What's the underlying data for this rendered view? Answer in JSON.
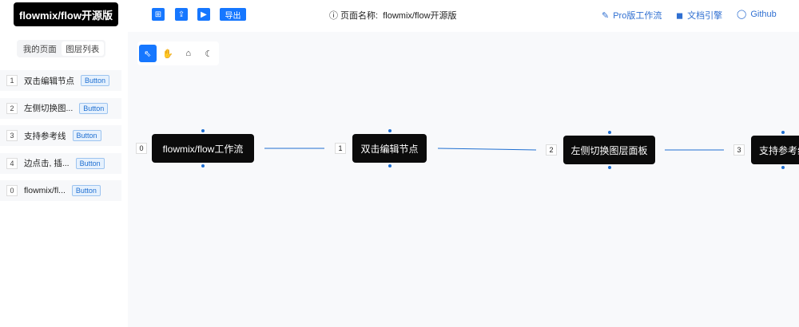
{
  "header": {
    "logo": "flowmix/flow开源版",
    "toolbar": [
      "⊞",
      "⇪",
      "▶"
    ],
    "export_label": "导出",
    "page_name_label": "ⓘ 页面名称:",
    "page_name": "flowmix/flow开源版",
    "links": [
      {
        "icon": "✎",
        "label": "Pro版工作流"
      },
      {
        "icon": "◼",
        "label": "文档引擎"
      },
      {
        "icon": "◯",
        "label": "Github"
      }
    ]
  },
  "sidebar": {
    "tabs": [
      "我的页面",
      "图层列表"
    ],
    "layers": [
      {
        "num": "1",
        "label": "双击编辑节点",
        "button": "Button"
      },
      {
        "num": "2",
        "label": "左侧切换图...",
        "button": "Button"
      },
      {
        "num": "3",
        "label": "支持参考线",
        "button": "Button"
      },
      {
        "num": "4",
        "label": "边点击, 插...",
        "button": "Button"
      },
      {
        "num": "0",
        "label": "flowmix/fl...",
        "button": "Button"
      }
    ]
  },
  "canvas": {
    "tools": [
      "⇖",
      "✋",
      "⌂",
      "☾"
    ],
    "nodes": [
      {
        "num": "0",
        "label": "flowmix/flow工作流"
      },
      {
        "num": "1",
        "label": "双击编辑节点"
      },
      {
        "num": "2",
        "label": "左侧切换图层面板"
      },
      {
        "num": "3",
        "label": "支持参考线"
      }
    ]
  }
}
